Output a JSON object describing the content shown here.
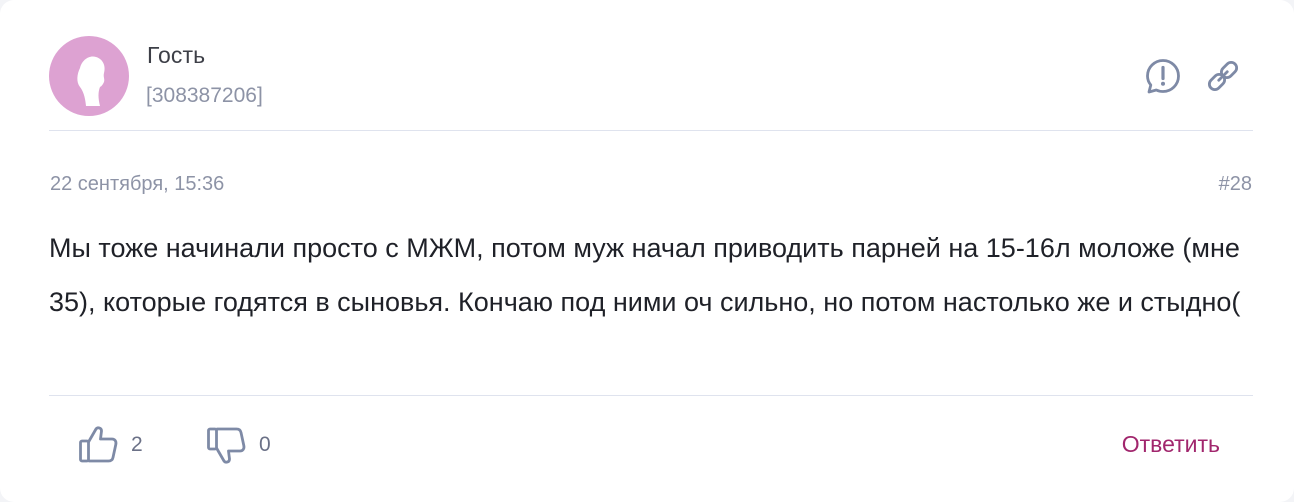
{
  "comment": {
    "author": {
      "name": "Гость",
      "id": "[308387206]",
      "avatar_icon": "person-silhouette-icon",
      "avatar_color": "#dda2d2"
    },
    "date": "22 сентября, 15:36",
    "number": "#28",
    "text": "Мы тоже начинали просто с МЖМ, потом муж начал приводить парней на 15-16л моложе (мне 35), которые годятся в сыновья. Кончаю под ними оч сильно, но потом настолько же и стыдно(",
    "actions": {
      "report_icon": "report-icon",
      "link_icon": "link-icon",
      "likes": "2",
      "dislikes": "0",
      "like_icon": "thumbs-up-icon",
      "dislike_icon": "thumbs-down-icon",
      "reply_label": "Ответить"
    },
    "colors": {
      "accent": "#a1266d",
      "muted": "#8d93a6",
      "icon": "#7e8aa6"
    }
  }
}
